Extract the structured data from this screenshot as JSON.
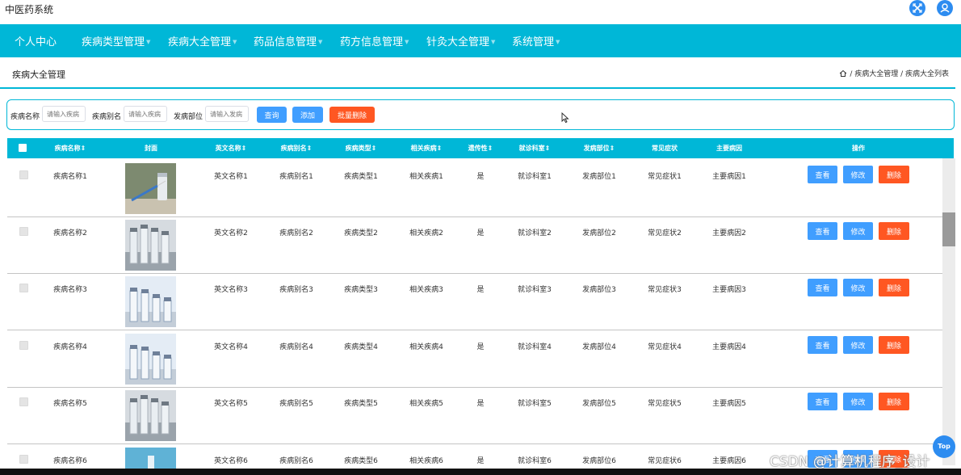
{
  "app": {
    "title": "中医药系统"
  },
  "nav": {
    "items": [
      {
        "label": "个人中心",
        "has_caret": false
      },
      {
        "label": "疾病类型管理",
        "has_caret": true
      },
      {
        "label": "疾病大全管理",
        "has_caret": true
      },
      {
        "label": "药品信息管理",
        "has_caret": true
      },
      {
        "label": "药方信息管理",
        "has_caret": true
      },
      {
        "label": "针灸大全管理",
        "has_caret": true
      },
      {
        "label": "系统管理",
        "has_caret": true
      }
    ]
  },
  "page": {
    "heading": "疾病大全管理"
  },
  "breadcrumb": {
    "path": "/ 疾病大全管理 / 疾病大全列表"
  },
  "search": {
    "field1_label": "疾病名称",
    "field1_placeholder": "请输入疾病",
    "field2_label": "疾病别名",
    "field2_placeholder": "请输入疾病",
    "field3_label": "发病部位",
    "field3_placeholder": "请输入发病",
    "query_label": "查询",
    "add_label": "添加",
    "batch_delete_label": "批量删除"
  },
  "table": {
    "headers": [
      "疾病名称⇕",
      "封面",
      "英文名称⇕",
      "疾病别名⇕",
      "疾病类型⇕",
      "相关疾病⇕",
      "遗传性⇕",
      "就诊科室⇕",
      "发病部位⇕",
      "常见症状",
      "主要病因",
      "操作"
    ],
    "actions": {
      "view": "查看",
      "edit": "修改",
      "delete": "删除"
    },
    "rows": [
      {
        "name": "疾病名称1",
        "english": "英文名称1",
        "alias": "疾病别名1",
        "type": "疾病类型1",
        "related": "相关疾病1",
        "hereditary": "是",
        "dept": "就诊科室1",
        "site": "发病部位1",
        "symptom": "常见症状1",
        "cause": "主要病因1",
        "image": "syringe-vial-image"
      },
      {
        "name": "疾病名称2",
        "english": "英文名称2",
        "alias": "疾病别名2",
        "type": "疾病类型2",
        "related": "相关疾病2",
        "hereditary": "是",
        "dept": "就诊科室2",
        "site": "发病部位2",
        "symptom": "常见症状2",
        "cause": "主要病因2",
        "image": "vials-image"
      },
      {
        "name": "疾病名称3",
        "english": "英文名称3",
        "alias": "疾病别名3",
        "type": "疾病类型3",
        "related": "相关疾病3",
        "hereditary": "是",
        "dept": "就诊科室3",
        "site": "发病部位3",
        "symptom": "常见症状3",
        "cause": "主要病因3",
        "image": "vials-image"
      },
      {
        "name": "疾病名称4",
        "english": "英文名称4",
        "alias": "疾病别名4",
        "type": "疾病类型4",
        "related": "相关疾病4",
        "hereditary": "是",
        "dept": "就诊科室4",
        "site": "发病部位4",
        "symptom": "常见症状4",
        "cause": "主要病因4",
        "image": "vials-image"
      },
      {
        "name": "疾病名称5",
        "english": "英文名称5",
        "alias": "疾病别名5",
        "type": "疾病类型5",
        "related": "相关疾病5",
        "hereditary": "是",
        "dept": "就诊科室5",
        "site": "发病部位5",
        "symptom": "常见症状5",
        "cause": "主要病因5",
        "image": "vials-image"
      },
      {
        "name": "疾病名称6",
        "english": "英文名称6",
        "alias": "疾病别名6",
        "type": "疾病类型6",
        "related": "相关疾病6",
        "hereditary": "是",
        "dept": "就诊科室6",
        "site": "发病部位6",
        "symptom": "常见症状6",
        "cause": "主要病因6",
        "image": "vial-image"
      }
    ]
  },
  "back_to_top": {
    "label": "Top"
  },
  "watermark": {
    "text": "CSDN @计算机程序_设计"
  },
  "colors": {
    "primary": "#00b7d7",
    "button_blue": "#409eff",
    "button_red": "#f56c6c",
    "button_orange": "#ff5722",
    "icon_blue": "#2d8cf0"
  },
  "icons": [
    "fullscreen-icon",
    "user-icon",
    "home-icon",
    "caret-down-icon"
  ]
}
